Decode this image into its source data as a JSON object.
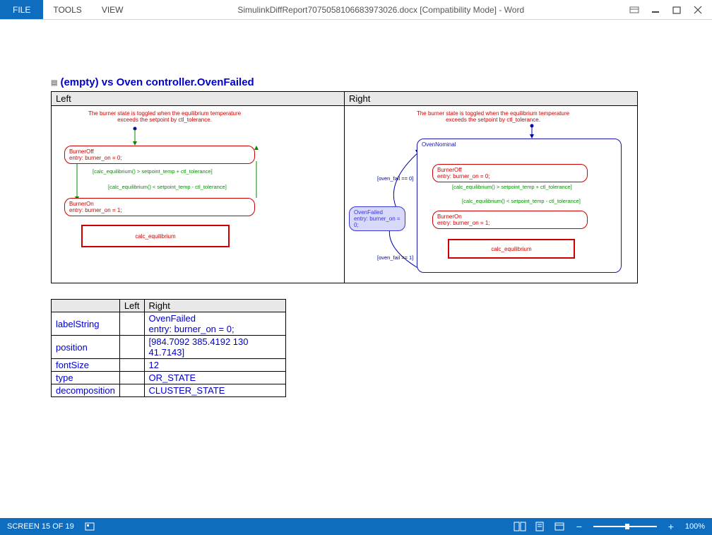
{
  "titlebar": {
    "file": "FILE",
    "tools": "TOOLS",
    "view": "VIEW",
    "title": "SimulinkDiffReport7075058106683973026.docx [Compatibility Mode] - Word"
  },
  "heading": "(empty) vs Oven controller.OvenFailed",
  "columns": {
    "left": "Left",
    "right": "Right"
  },
  "diagram": {
    "annotation": "The burner state is toggled when the equilibrium temperature\nexceeds the setpoint by ctl_tolerance.",
    "burnerOff": "BurnerOff\nentry: burner_on = 0;",
    "burnerOn": "BurnerOn\nentry: burner_on = 1;",
    "trans1": "[calc_equilibrium() > setpoint_temp + ctl_tolerance]",
    "trans2": "[calc_equilibrium() < setpoint_temp - ctl_tolerance]",
    "func": "calc_equilibrium",
    "ovenNominal": "OvenNominal",
    "ovenFailed": "OvenFailed\nentry: burner_on = 0;",
    "ovenFailEq0": "[oven_fail == 0]",
    "ovenFailEq1": "[oven_fail == 1]"
  },
  "properties": {
    "headers": [
      "",
      "Left",
      "Right"
    ],
    "rows": [
      {
        "key": "labelString",
        "left": "",
        "right": "OvenFailed\nentry: burner_on = 0;"
      },
      {
        "key": "position",
        "left": "",
        "right": "[984.7092 385.4192 130 41.7143]"
      },
      {
        "key": "fontSize",
        "left": "",
        "right": "12"
      },
      {
        "key": "type",
        "left": "",
        "right": "OR_STATE"
      },
      {
        "key": "decomposition",
        "left": "",
        "right": "CLUSTER_STATE"
      }
    ]
  },
  "statusbar": {
    "screen": "SCREEN 15 OF 19",
    "zoom": "100%"
  }
}
